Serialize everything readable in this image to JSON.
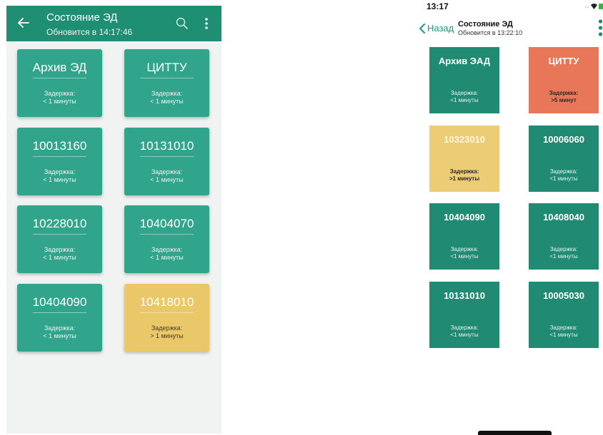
{
  "android": {
    "title": "Состояние ЭД",
    "subtitle": "Обновится в 14:17:46",
    "colors": {
      "toolbar": "#1f8f73",
      "tile": "#31a58b",
      "tile_delayed": "#eac86a",
      "background": "#f1f2f2"
    },
    "tiles": [
      {
        "name": "Архив ЭД",
        "label": "Задержка:",
        "value": "< 1 минуты"
      },
      {
        "name": "ЦИТТУ",
        "label": "Задержка:",
        "value": "< 1 минуты"
      },
      {
        "name": "10013160",
        "label": "Задержка:",
        "value": "< 1 минуты"
      },
      {
        "name": "10131010",
        "label": "Задержка:",
        "value": "< 1 минуты"
      },
      {
        "name": "10228010",
        "label": "Задержка:",
        "value": "< 1 минуты"
      },
      {
        "name": "10404070",
        "label": "Задержка:",
        "value": "< 1 минуты"
      },
      {
        "name": "10404090",
        "label": "Задержка:",
        "value": "< 1 минуты"
      },
      {
        "name": "10418010",
        "label": "Задержка:",
        "value": "> 1 минуты"
      }
    ]
  },
  "ios": {
    "time": "13:17",
    "back_label": "Назад",
    "title": "Состояние ЭД",
    "subtitle": "Обновится в 13:22:10",
    "colors": {
      "accent": "#1a9a7c",
      "tile": "#208a72",
      "tile_alert": "#e8775a",
      "tile_delayed": "#eccc74"
    },
    "tiles": [
      {
        "name": "Архив ЭАД",
        "label": "Задержка:",
        "value": "<1 минуты"
      },
      {
        "name": "ЦИТТУ",
        "label": "Задержка:",
        "value": ">5 минут"
      },
      {
        "name": "10323010",
        "label": "Задержка:",
        "value": ">1 минуты"
      },
      {
        "name": "10006060",
        "label": "Задержка:",
        "value": "<1 минуты"
      },
      {
        "name": "10404090",
        "label": "Задержка:",
        "value": "<1 минуты"
      },
      {
        "name": "10408040",
        "label": "Задержка:",
        "value": "<1 минуты"
      },
      {
        "name": "10131010",
        "label": "Задержка:",
        "value": "<1 минуты"
      },
      {
        "name": "10005030",
        "label": "Задержка:",
        "value": "<1 минуты"
      }
    ]
  }
}
